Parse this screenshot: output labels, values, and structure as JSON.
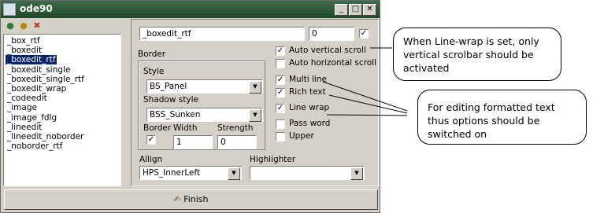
{
  "window": {
    "title": "ode90",
    "controls": {
      "minimize": "_",
      "maximize": "□",
      "close": "✕"
    }
  },
  "left": {
    "toolbar_icons": [
      "components-icon",
      "objects-icon",
      "delete-icon"
    ],
    "items": [
      "_box_rtf",
      "_boxedit",
      "_boxedit_rtf",
      "_boxedit_single",
      "_boxedit_single_rtf",
      "_boxedit_wrap",
      "_codeedit",
      "_image",
      "_image_fdlg",
      "_lineedit",
      "_lineedit_noborder",
      "_noborder_rtf"
    ],
    "selected_index": 2
  },
  "form": {
    "name_value": "_boxedit_rtf",
    "number_value": "0",
    "top_checkbox_checked": true,
    "border_group_label": "Border",
    "style_label": "Style",
    "style_value": "BS_Panel",
    "shadow_label": "Shadow style",
    "shadow_value": "BSS_Sunken",
    "border_label": "Border",
    "width_label": "Width",
    "strength_label": "Strength",
    "border_checked": true,
    "width_value": "1",
    "strength_value": "0",
    "allign_label": "Allign",
    "allign_value": "HPS_InnerLeft",
    "highlighter_label": "Highlighter",
    "highlighter_value": "",
    "options": [
      {
        "label": "Auto vertical scroll",
        "checked": true
      },
      {
        "label": "Auto horizontal scroll",
        "checked": false
      },
      {
        "label": "Multi line",
        "checked": true
      },
      {
        "label": "Rich text",
        "checked": true
      },
      {
        "label": "Line wrap",
        "checked": true
      },
      {
        "label": "Pass word",
        "checked": false
      },
      {
        "label": "Upper",
        "checked": false
      }
    ]
  },
  "finish_label": "Finish",
  "callouts": {
    "line_wrap": "When Line-wrap is set, only vertical scrolbar should be activated",
    "formatted": "For editing formatted text thus options should be switched on"
  }
}
